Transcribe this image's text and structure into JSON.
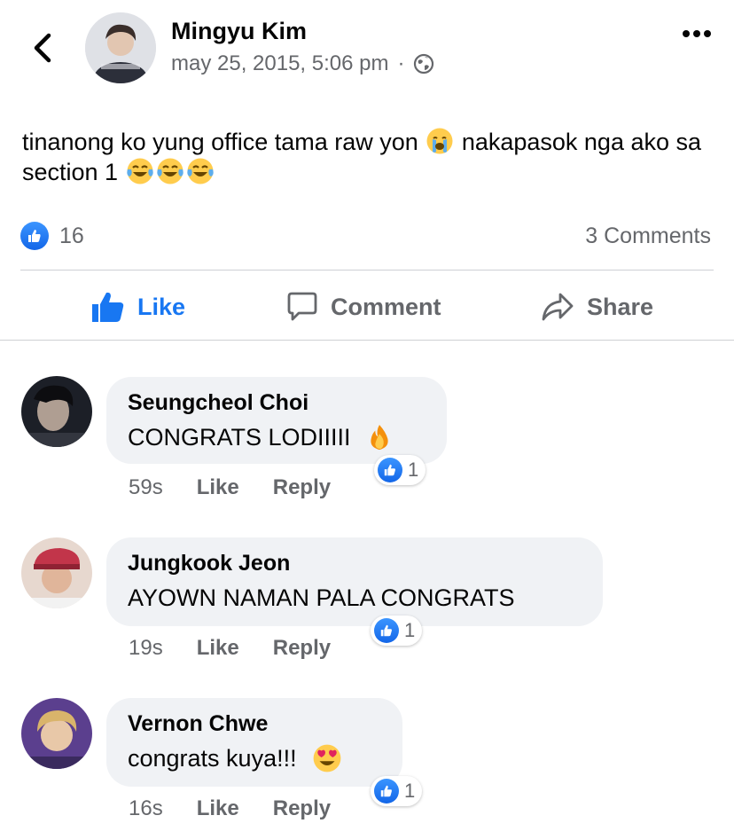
{
  "post": {
    "author": "Mingyu Kim",
    "timestamp": "may 25, 2015, 5:06 pm",
    "separator": "·",
    "privacy_icon": "globe-icon",
    "text_part1": "tinanong ko yung office tama raw yon",
    "text_part2": "nakapasok nga ako sa section 1",
    "reaction_count": "16",
    "comments_label": "3 Comments"
  },
  "actions": {
    "like": "Like",
    "comment": "Comment",
    "share": "Share"
  },
  "comments": [
    {
      "name": "Seungcheol Choi",
      "text": "CONGRATS LODIIIII",
      "time": "59s",
      "like": "Like",
      "reply": "Reply",
      "reactions": "1"
    },
    {
      "name": "Jungkook Jeon",
      "text": "AYOWN NAMAN PALA CONGRATS",
      "time": "19s",
      "like": "Like",
      "reply": "Reply",
      "reactions": "1"
    },
    {
      "name": "Vernon Chwe",
      "text": "congrats kuya!!!",
      "time": "16s",
      "like": "Like",
      "reply": "Reply",
      "reactions": "1"
    }
  ],
  "colors": {
    "accent": "#1877f2",
    "secondary_text": "#65676b",
    "bubble": "#f0f2f5"
  }
}
